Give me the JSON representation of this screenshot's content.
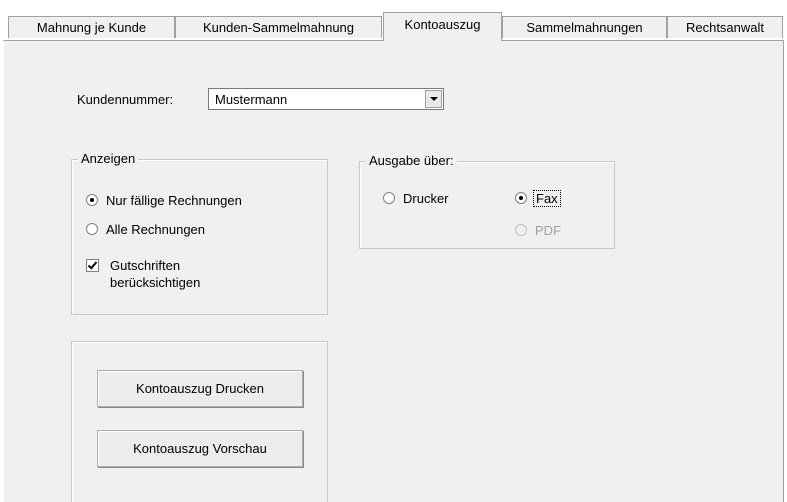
{
  "tabs": [
    {
      "label": "Mahnung je Kunde"
    },
    {
      "label": "Kunden-Sammelmahnung"
    },
    {
      "label": "Kontoauszug",
      "active": true
    },
    {
      "label": "Sammelmahnungen"
    },
    {
      "label": "Rechtsanwalt"
    }
  ],
  "customer": {
    "label": "Kundennummer:",
    "value": "Mustermann"
  },
  "display_group": {
    "title": "Anzeigen",
    "radio_due": "Nur fällige Rechnungen",
    "radio_all": "Alle Rechnungen",
    "checkbox_credits_line1": "Gutschriften",
    "checkbox_credits_line2": "berücksichtigen",
    "selected": "due",
    "credits_checked": true
  },
  "output_group": {
    "title": "Ausgabe über:",
    "radio_printer": "Drucker",
    "radio_fax": "Fax",
    "radio_pdf": "PDF",
    "selected": "fax",
    "pdf_enabled": false
  },
  "actions": {
    "print_button": "Kontoauszug Drucken",
    "preview_button": "Kontoauszug Vorschau"
  }
}
